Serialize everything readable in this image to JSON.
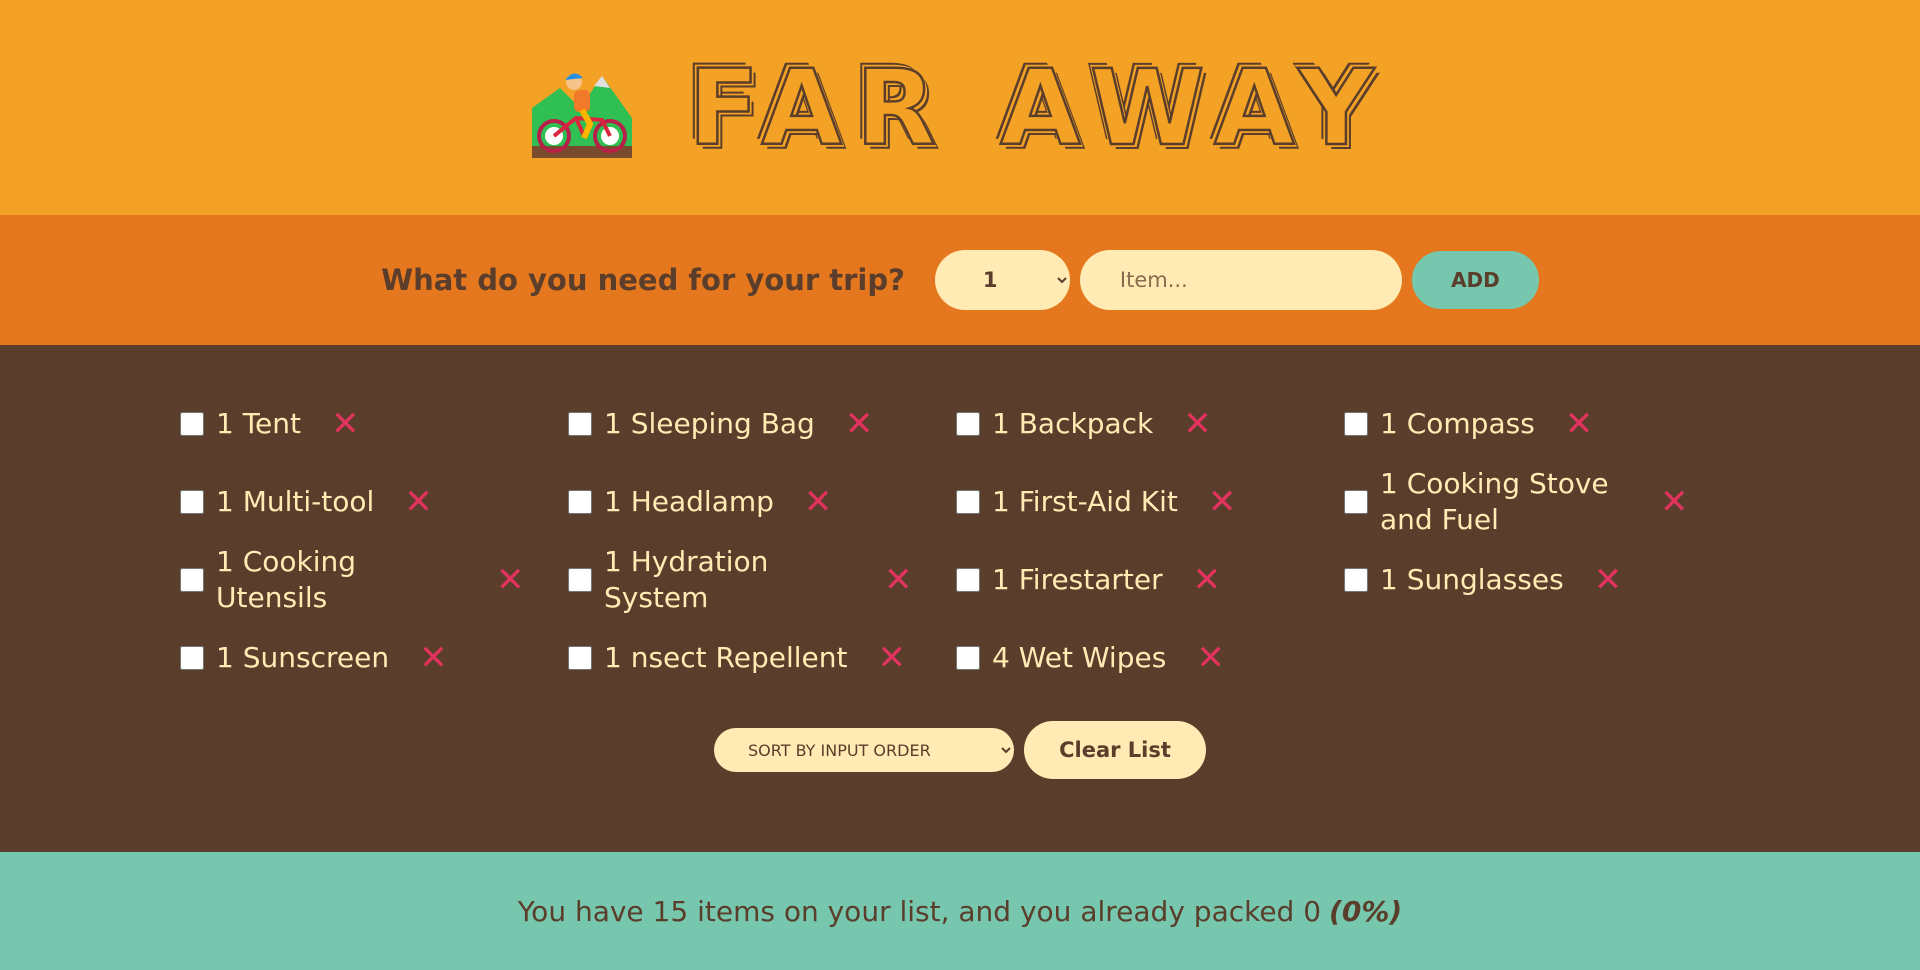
{
  "header": {
    "logo_icon": "mountain-bicyclist-icon",
    "title": "Far Away"
  },
  "form": {
    "question": "What do you need for your trip?",
    "quantity_selected": "1",
    "item_placeholder": "Item...",
    "add_label": "ADD"
  },
  "items": [
    {
      "quantity": "1",
      "description": "Tent",
      "label": "1 Tent",
      "packed": false
    },
    {
      "quantity": "1",
      "description": "Sleeping Bag",
      "label": "1 Sleeping Bag",
      "packed": false
    },
    {
      "quantity": "1",
      "description": "Backpack",
      "label": "1 Backpack",
      "packed": false
    },
    {
      "quantity": "1",
      "description": "Compass",
      "label": "1 Compass",
      "packed": false
    },
    {
      "quantity": "1",
      "description": "Multi-tool",
      "label": "1 Multi-tool",
      "packed": false
    },
    {
      "quantity": "1",
      "description": "Headlamp",
      "label": "1 Headlamp",
      "packed": false
    },
    {
      "quantity": "1",
      "description": "First-Aid Kit",
      "label": "1 First-Aid Kit",
      "packed": false
    },
    {
      "quantity": "1",
      "description": "Cooking Stove and Fuel",
      "label": "1 Cooking Stove and Fuel",
      "packed": false
    },
    {
      "quantity": "1",
      "description": "Cooking Utensils",
      "label": "1 Cooking Utensils",
      "packed": false
    },
    {
      "quantity": "1",
      "description": "Hydration System",
      "label": "1 Hydration System",
      "packed": false
    },
    {
      "quantity": "1",
      "description": "Firestarter",
      "label": "1 Firestarter",
      "packed": false
    },
    {
      "quantity": "1",
      "description": "Sunglasses",
      "label": "1 Sunglasses",
      "packed": false
    },
    {
      "quantity": "1",
      "description": "Sunscreen",
      "label": "1 Sunscreen",
      "packed": false
    },
    {
      "quantity": "1",
      "description": "nsect Repellent",
      "label": "1 nsect Repellent",
      "packed": false
    },
    {
      "quantity": "4",
      "description": "Wet Wipes",
      "label": "4 Wet Wipes",
      "packed": false
    }
  ],
  "delete_icon": "close-icon",
  "delete_glyph": "✕",
  "actions": {
    "sort_selected": "SORT BY INPUT ORDER",
    "clear_label": "Clear List"
  },
  "stats": {
    "text": "You have 15 items on your list, and you already packed 0",
    "percent": "(0%)"
  },
  "colors": {
    "header_bg": "#f4a226",
    "form_bg": "#e5771e",
    "list_bg": "#5a3e2b",
    "stats_bg": "#76c7ad",
    "cream": "#ffebb3",
    "delete_red": "#e2325e"
  }
}
